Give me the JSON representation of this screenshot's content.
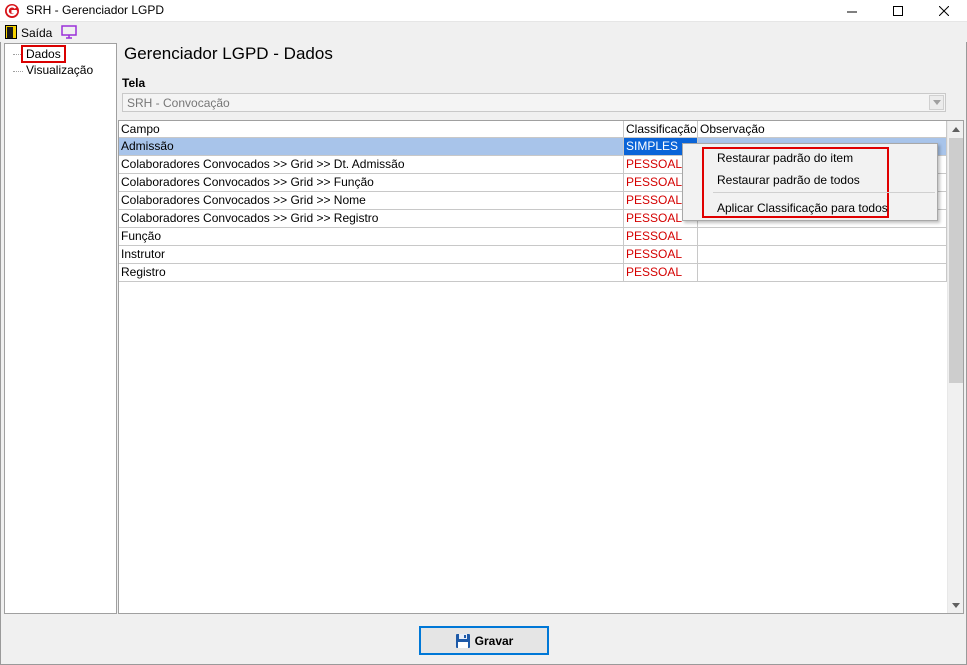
{
  "window": {
    "title": "SRH - Gerenciador LGPD",
    "brand_color": "#d7141a"
  },
  "menubar": {
    "exit_label": "Saída"
  },
  "tree": {
    "items": [
      {
        "label": "Dados"
      },
      {
        "label": "Visualização"
      }
    ]
  },
  "main": {
    "title": "Gerenciador LGPD - Dados",
    "tela_label": "Tela",
    "tela_value": "SRH - Convocação"
  },
  "grid": {
    "columns": [
      "Campo",
      "Classificação",
      "Observação"
    ],
    "rows": [
      {
        "campo": "Admissão",
        "classificacao": "SIMPLES",
        "observacao": ""
      },
      {
        "campo": "Colaboradores Convocados >> Grid >> Dt. Admissão",
        "classificacao": "PESSOAL",
        "observacao": ""
      },
      {
        "campo": "Colaboradores Convocados >> Grid >> Função",
        "classificacao": "PESSOAL",
        "observacao": ""
      },
      {
        "campo": "Colaboradores Convocados >> Grid >> Nome",
        "classificacao": "PESSOAL",
        "observacao": ""
      },
      {
        "campo": "Colaboradores Convocados >> Grid >> Registro",
        "classificacao": "PESSOAL",
        "observacao": ""
      },
      {
        "campo": "Função",
        "classificacao": "PESSOAL",
        "observacao": ""
      },
      {
        "campo": "Instrutor",
        "classificacao": "PESSOAL",
        "observacao": ""
      },
      {
        "campo": "Registro",
        "classificacao": "PESSOAL",
        "observacao": ""
      }
    ],
    "selected_row": 0
  },
  "context_menu": {
    "items": [
      {
        "label": "Restaurar padrão do item"
      },
      {
        "label": "Restaurar padrão de todos"
      },
      {
        "label": "Aplicar Classificação para todos"
      }
    ]
  },
  "footer": {
    "save_label": "Gravar"
  },
  "colors": {
    "selection_row": "#a8c4ea",
    "selection_cell": "#0a64d8",
    "pessoal_text": "#d40000",
    "highlight_border": "#e00000"
  }
}
